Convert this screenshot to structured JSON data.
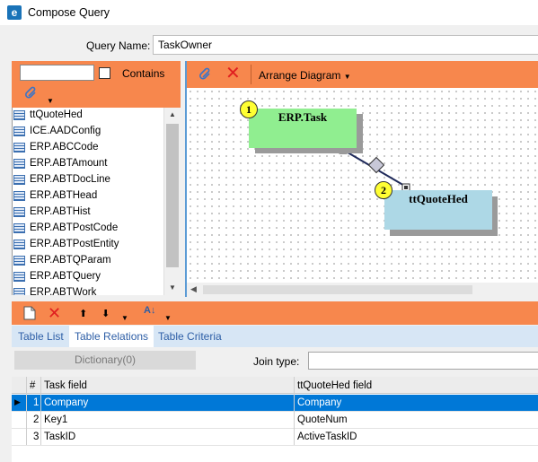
{
  "window": {
    "title": "Compose Query",
    "logo_letter": "e"
  },
  "query": {
    "label": "Query Name:",
    "value": "TaskOwner"
  },
  "left_panel": {
    "search_value": "",
    "contains_label": "Contains",
    "tables": [
      "ttQuoteHed",
      "ICE.AADConfig",
      "ERP.ABCCode",
      "ERP.ABTAmount",
      "ERP.ABTDocLine",
      "ERP.ABTHead",
      "ERP.ABTHist",
      "ERP.ABTPostCode",
      "ERP.ABTPostEntity",
      "ERP.ABTQParam",
      "ERP.ABTQuery",
      "ERP.ABTWork"
    ]
  },
  "diagram": {
    "arrange_label": "Arrange Diagram",
    "nodes": [
      {
        "number": "1",
        "name": "ERP.Task",
        "color": "#90ee90"
      },
      {
        "number": "2",
        "name": "ttQuoteHed",
        "color": "#add8e6"
      }
    ]
  },
  "tabs": [
    {
      "label": "Table List",
      "active": false
    },
    {
      "label": "Table Relations",
      "active": true
    },
    {
      "label": "Table Criteria",
      "active": false
    }
  ],
  "relations": {
    "dictionary_button": "Dictionary(0)",
    "join_type_label": "Join type:",
    "join_type_value": ""
  },
  "grid": {
    "headers": {
      "num": "#",
      "left": "Task field",
      "right": "ttQuoteHed field"
    },
    "rows": [
      {
        "num": "1",
        "left": "Company",
        "right": "Company",
        "selected": true
      },
      {
        "num": "2",
        "left": "Key1",
        "right": "QuoteNum",
        "selected": false
      },
      {
        "num": "3",
        "left": "TaskID",
        "right": "ActiveTaskID",
        "selected": false
      }
    ]
  },
  "colors": {
    "toolbar_orange": "#f7874d",
    "accent_blue": "#0078d7",
    "tab_bg": "#d7e6f5"
  }
}
